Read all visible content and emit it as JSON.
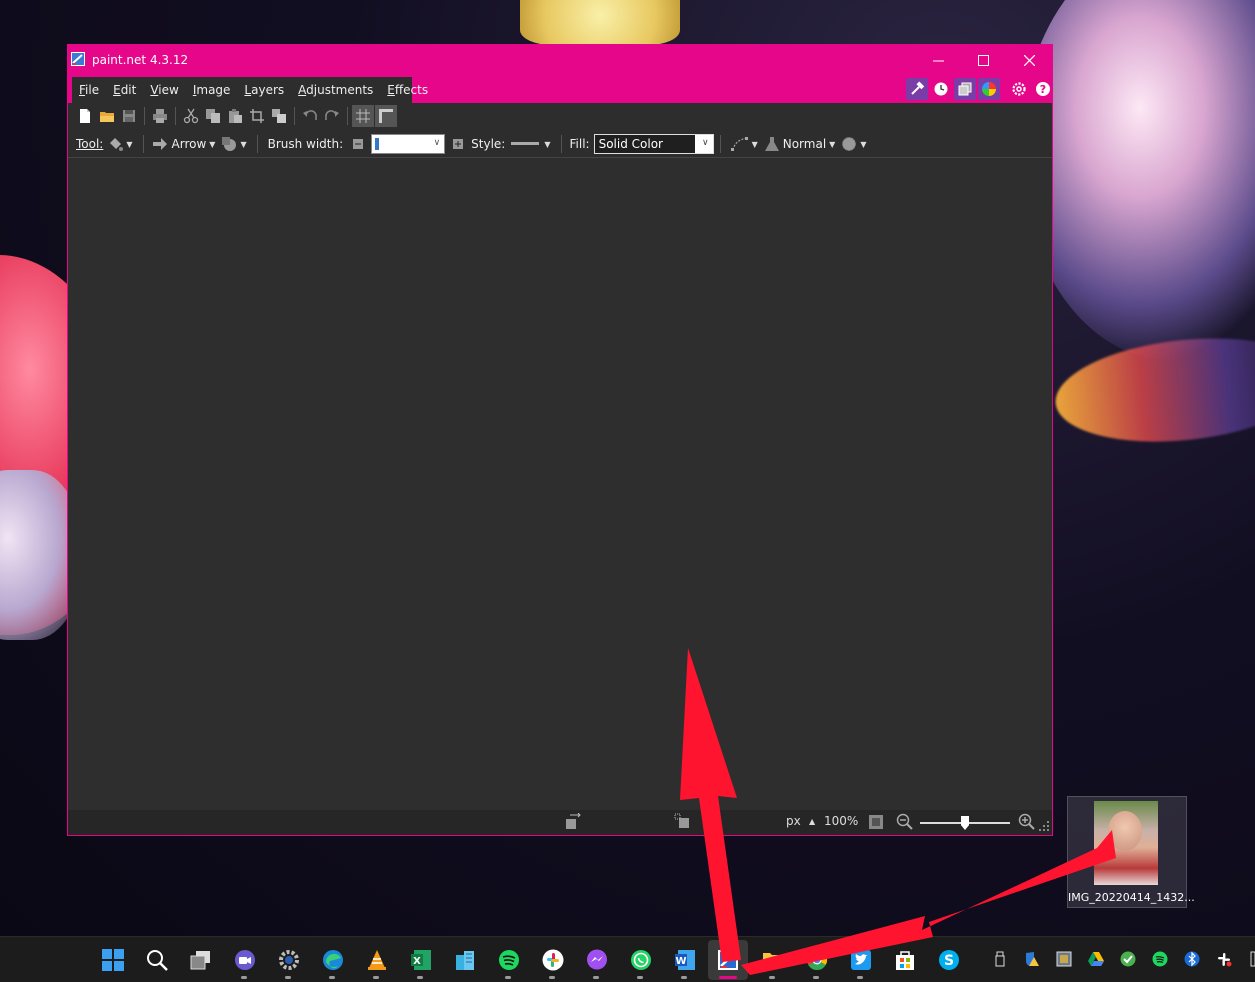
{
  "window": {
    "title": "paint.net 4.3.12",
    "minimize": "—",
    "maximize": "☐",
    "close": "✕"
  },
  "menu": {
    "file": {
      "u": "F",
      "rest": "ile"
    },
    "edit": {
      "u": "E",
      "rest": "dit"
    },
    "view": {
      "u": "V",
      "rest": "iew"
    },
    "image": {
      "u": "I",
      "rest": "mage"
    },
    "layers": {
      "u": "L",
      "rest": "ayers"
    },
    "adjustments": {
      "u": "A",
      "rest": "djustments"
    },
    "effects": {
      "u": "E",
      "rest": "ffects"
    }
  },
  "toolbar2": {
    "tool_label": "Tool:",
    "arrow_label": "Arrow",
    "brush_width_label": "Brush width:",
    "style_label": "Style:",
    "fill_label": "Fill:",
    "fill_value": "Solid Color",
    "blend_mode": "Normal"
  },
  "status": {
    "units": "px",
    "zoom": "100%",
    "zoom_slider_fraction": 0.5
  },
  "desktop": {
    "file_label": "IMG_20220414_1432..."
  },
  "colors": {
    "accent": "#e6068a",
    "panel": "#2d2d2d",
    "annotation_arrow": "#ff1430"
  }
}
